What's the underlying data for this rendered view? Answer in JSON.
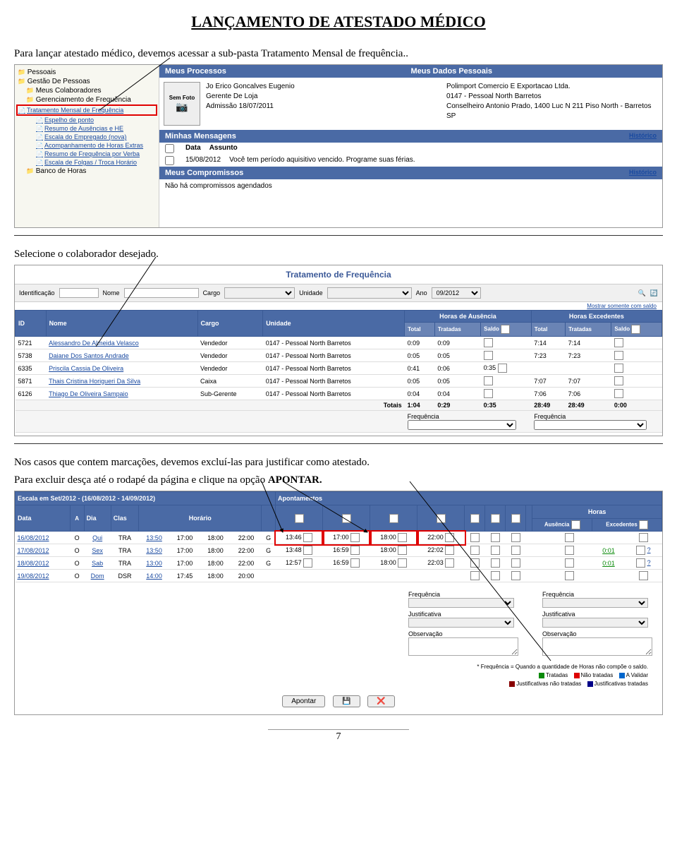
{
  "doc": {
    "title": "LANÇAMENTO DE ATESTADO MÉDICO",
    "p1": "Para lançar atestado médico, devemos acessar a sub-pasta Tratamento Mensal de frequência..",
    "p2": "Selecione o colaborador desejado.",
    "p3_a": "Nos casos que contem marcações, devemos excluí-las para justificar como atestado.",
    "p3_b": "Para excluir desça até o rodapé da página e clique na opção ",
    "p3_c": "APONTAR.",
    "page": "7"
  },
  "scr1": {
    "nav": {
      "pessoais": "Pessoais",
      "gestao": "Gestão De Pessoas",
      "meus_colab": "Meus Colaboradores",
      "gerenc": "Gerenciamento de Frequência",
      "tratamento": "Tratamento Mensal de Frequência",
      "espelho": "Espelho de ponto",
      "resumo_aus": "Resumo de Ausências e HE",
      "escala_emp": "Escala do Empregado (nova)",
      "acomp": "Acompanhamento de Horas Extras",
      "resumo_freq": "Resumo de Frequência por Verba",
      "escala_folgas": "Escala de Folgas / Troca Horário",
      "banco": "Banco de Horas"
    },
    "header": {
      "left": "Meus Processos",
      "right": "Meus Dados Pessoais"
    },
    "photo": {
      "label": "Sem Foto"
    },
    "emp": {
      "nome": "Jo Erico Goncalves Eugenio",
      "cargo": "Gerente De Loja",
      "admissao": "Admissão 18/07/2011",
      "empresa": "Polimport Comercio E Exportacao Ltda.",
      "unidade": "0147 - Pessoal North Barretos",
      "endereco": "Conselheiro Antonio Prado, 1400 Luc N 211 Piso North - Barretos SP"
    },
    "mensagens": {
      "title": "Minhas Mensagens",
      "hist": "Histórico",
      "h_data": "Data",
      "h_assunto": "Assunto",
      "row_data": "15/08/2012",
      "row_assunto": "Você tem período aquisitivo vencido. Programe suas férias."
    },
    "compromissos": {
      "title": "Meus Compromissos",
      "hist": "Histórico",
      "none": "Não há compromissos agendados"
    }
  },
  "scr2": {
    "title": "Tratamento de Frequência",
    "filters": {
      "id": "Identificação",
      "nome": "Nome",
      "cargo": "Cargo",
      "unidade": "Unidade",
      "ano": "Ano",
      "ano_val": "09/2012",
      "mostrar": "Mostrar somente com saldo"
    },
    "head": {
      "id": "ID",
      "nome": "Nome",
      "cargo": "Cargo",
      "unidade": "Unidade",
      "aus": "Horas de Ausência",
      "exc": "Horas Excedentes",
      "total": "Total",
      "tratadas": "Tratadas",
      "saldo": "Saldo"
    },
    "rows": [
      {
        "id": "5721",
        "nome": "Alessandro De Almeida Velasco",
        "cargo": "Vendedor",
        "unidade": "0147 - Pessoal North Barretos",
        "a_t": "0:09",
        "a_tr": "0:09",
        "a_s": "",
        "e_t": "7:14",
        "e_tr": "7:14",
        "e_s": ""
      },
      {
        "id": "5738",
        "nome": "Daiane Dos Santos Andrade",
        "cargo": "Vendedor",
        "unidade": "0147 - Pessoal North Barretos",
        "a_t": "0:05",
        "a_tr": "0:05",
        "a_s": "",
        "e_t": "7:23",
        "e_tr": "7:23",
        "e_s": ""
      },
      {
        "id": "6335",
        "nome": "Priscila Cassia De Oliveira",
        "cargo": "Vendedor",
        "unidade": "0147 - Pessoal North Barretos",
        "a_t": "0:41",
        "a_tr": "0:06",
        "a_s": "0:35",
        "e_t": "",
        "e_tr": "",
        "e_s": ""
      },
      {
        "id": "5871",
        "nome": "Thais Cristina Horigueri Da Silva",
        "cargo": "Caixa",
        "unidade": "0147 - Pessoal North Barretos",
        "a_t": "0:05",
        "a_tr": "0:05",
        "a_s": "",
        "e_t": "7:07",
        "e_tr": "7:07",
        "e_s": ""
      },
      {
        "id": "6126",
        "nome": "Thiago De Oliveira Sampaio",
        "cargo": "Sub-Gerente",
        "unidade": "0147 - Pessoal North Barretos",
        "a_t": "0:04",
        "a_tr": "0:04",
        "a_s": "",
        "e_t": "7:06",
        "e_tr": "7:06",
        "e_s": ""
      }
    ],
    "totais": {
      "label": "Totais",
      "a_t": "1:04",
      "a_tr": "0:29",
      "a_s": "0:35",
      "e_t": "28:49",
      "e_tr": "28:49",
      "e_s": "0:00"
    },
    "freq": "Frequência"
  },
  "scr3": {
    "escala_title": "Escala em Set/2012 - (16/08/2012 - 14/09/2012)",
    "apont_title": "Apontamentos",
    "head": {
      "data": "Data",
      "a": "A",
      "dia": "Dia",
      "clas": "Clas",
      "horario": "Horário",
      "horas": "Horas",
      "aus": "Ausência",
      "exc": "Excedentes"
    },
    "rows": [
      {
        "data": "16/08/2012",
        "a": "O",
        "dia": "Qui",
        "clas": "TRA",
        "h1": "13:50",
        "h2": "17:00",
        "h3": "18:00",
        "h4": "22:00",
        "g": "G",
        "m1": "13:46",
        "m2": "17:00",
        "m3": "18:00",
        "m4": "22:00",
        "aus": "",
        "exc": "",
        "red": true
      },
      {
        "data": "17/08/2012",
        "a": "O",
        "dia": "Sex",
        "clas": "TRA",
        "h1": "13:50",
        "h2": "17:00",
        "h3": "18:00",
        "h4": "22:00",
        "g": "G",
        "m1": "13:48",
        "m2": "16:59",
        "m3": "18:00",
        "m4": "22:02",
        "aus": "",
        "exc": "0:01",
        "q": "?",
        "red": false
      },
      {
        "data": "18/08/2012",
        "a": "O",
        "dia": "Sab",
        "clas": "TRA",
        "h1": "13:00",
        "h2": "17:00",
        "h3": "18:00",
        "h4": "22:00",
        "g": "G",
        "m1": "12:57",
        "m2": "16:59",
        "m3": "18:00",
        "m4": "22:03",
        "aus": "",
        "exc": "0:01",
        "q": "?",
        "red": false
      },
      {
        "data": "19/08/2012",
        "a": "O",
        "dia": "Dom",
        "clas": "DSR",
        "h1": "14:00",
        "h2": "17:45",
        "h3": "18:00",
        "h4": "20:00",
        "g": "",
        "m1": "",
        "m2": "",
        "m3": "",
        "m4": "",
        "aus": "",
        "exc": "",
        "red": false
      }
    ],
    "bottom": {
      "freq": "Frequência",
      "just": "Justificativa",
      "obs": "Observação",
      "legend_note": "* Frequência = Quando a quantidade de Horas não compõe o saldo.",
      "l_trat": "Tratadas",
      "l_nao": "Não tratadas",
      "l_val": "A Validar",
      "l_jnt": "Justificativas não tratadas",
      "l_jt": "Justificativas tratadas",
      "btn_apontar": "Apontar"
    }
  }
}
